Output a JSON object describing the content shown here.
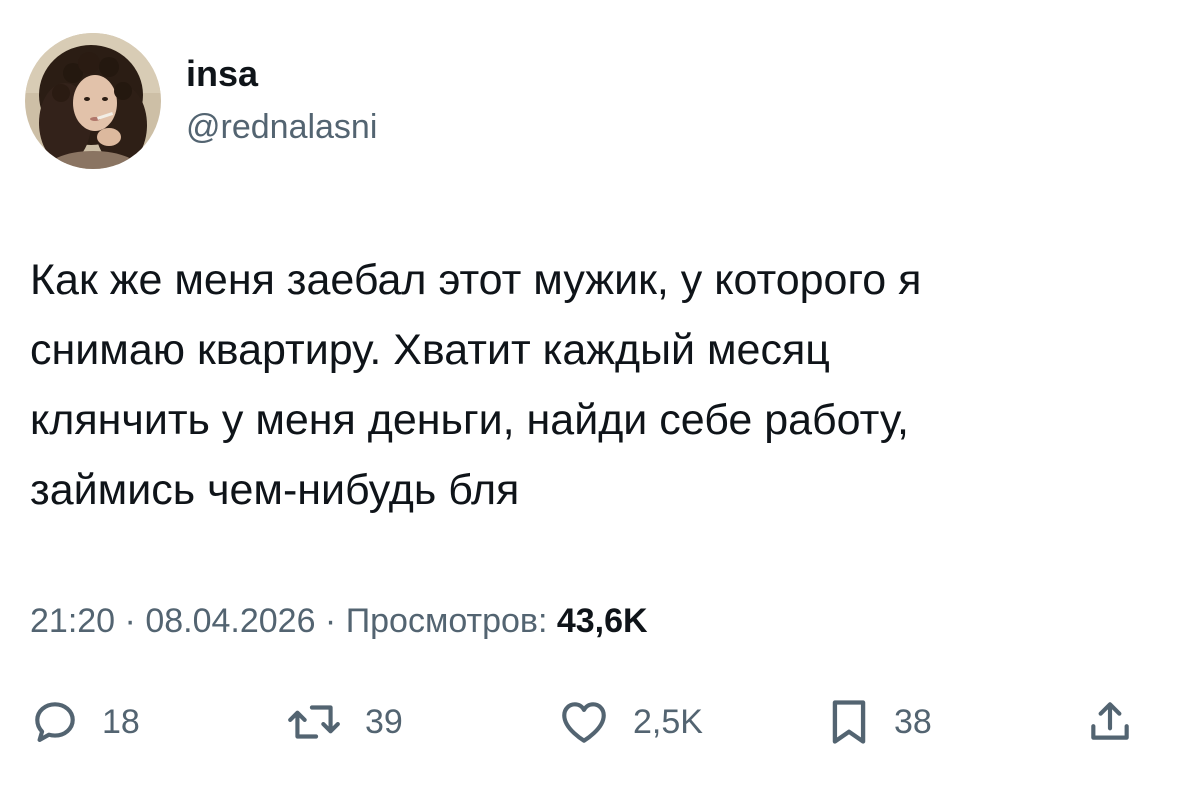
{
  "author": {
    "display_name": "insa",
    "handle": "@rednalasni"
  },
  "tweet": {
    "lines": [
      "Как же меня заебал этот мужик, у которого я",
      "снимаю квартиру. Хватит каждый месяц",
      "клянчить у меня деньги, найди себе работу,",
      "займись чем-нибудь бля"
    ],
    "time": "21:20",
    "date": "08.04.2026",
    "separator": " · ",
    "views_label": "Просмотров: ",
    "views_count": "43,6K"
  },
  "actions": {
    "reply_count": "18",
    "retweet_count": "39",
    "like_count": "2,5K",
    "bookmark_count": "38"
  },
  "icons": {
    "reply": "reply-icon",
    "retweet": "retweet-icon",
    "like": "heart-icon",
    "bookmark": "bookmark-icon",
    "share": "share-icon"
  },
  "colors": {
    "text": "#0f1419",
    "secondary": "#536471",
    "background": "#ffffff"
  }
}
